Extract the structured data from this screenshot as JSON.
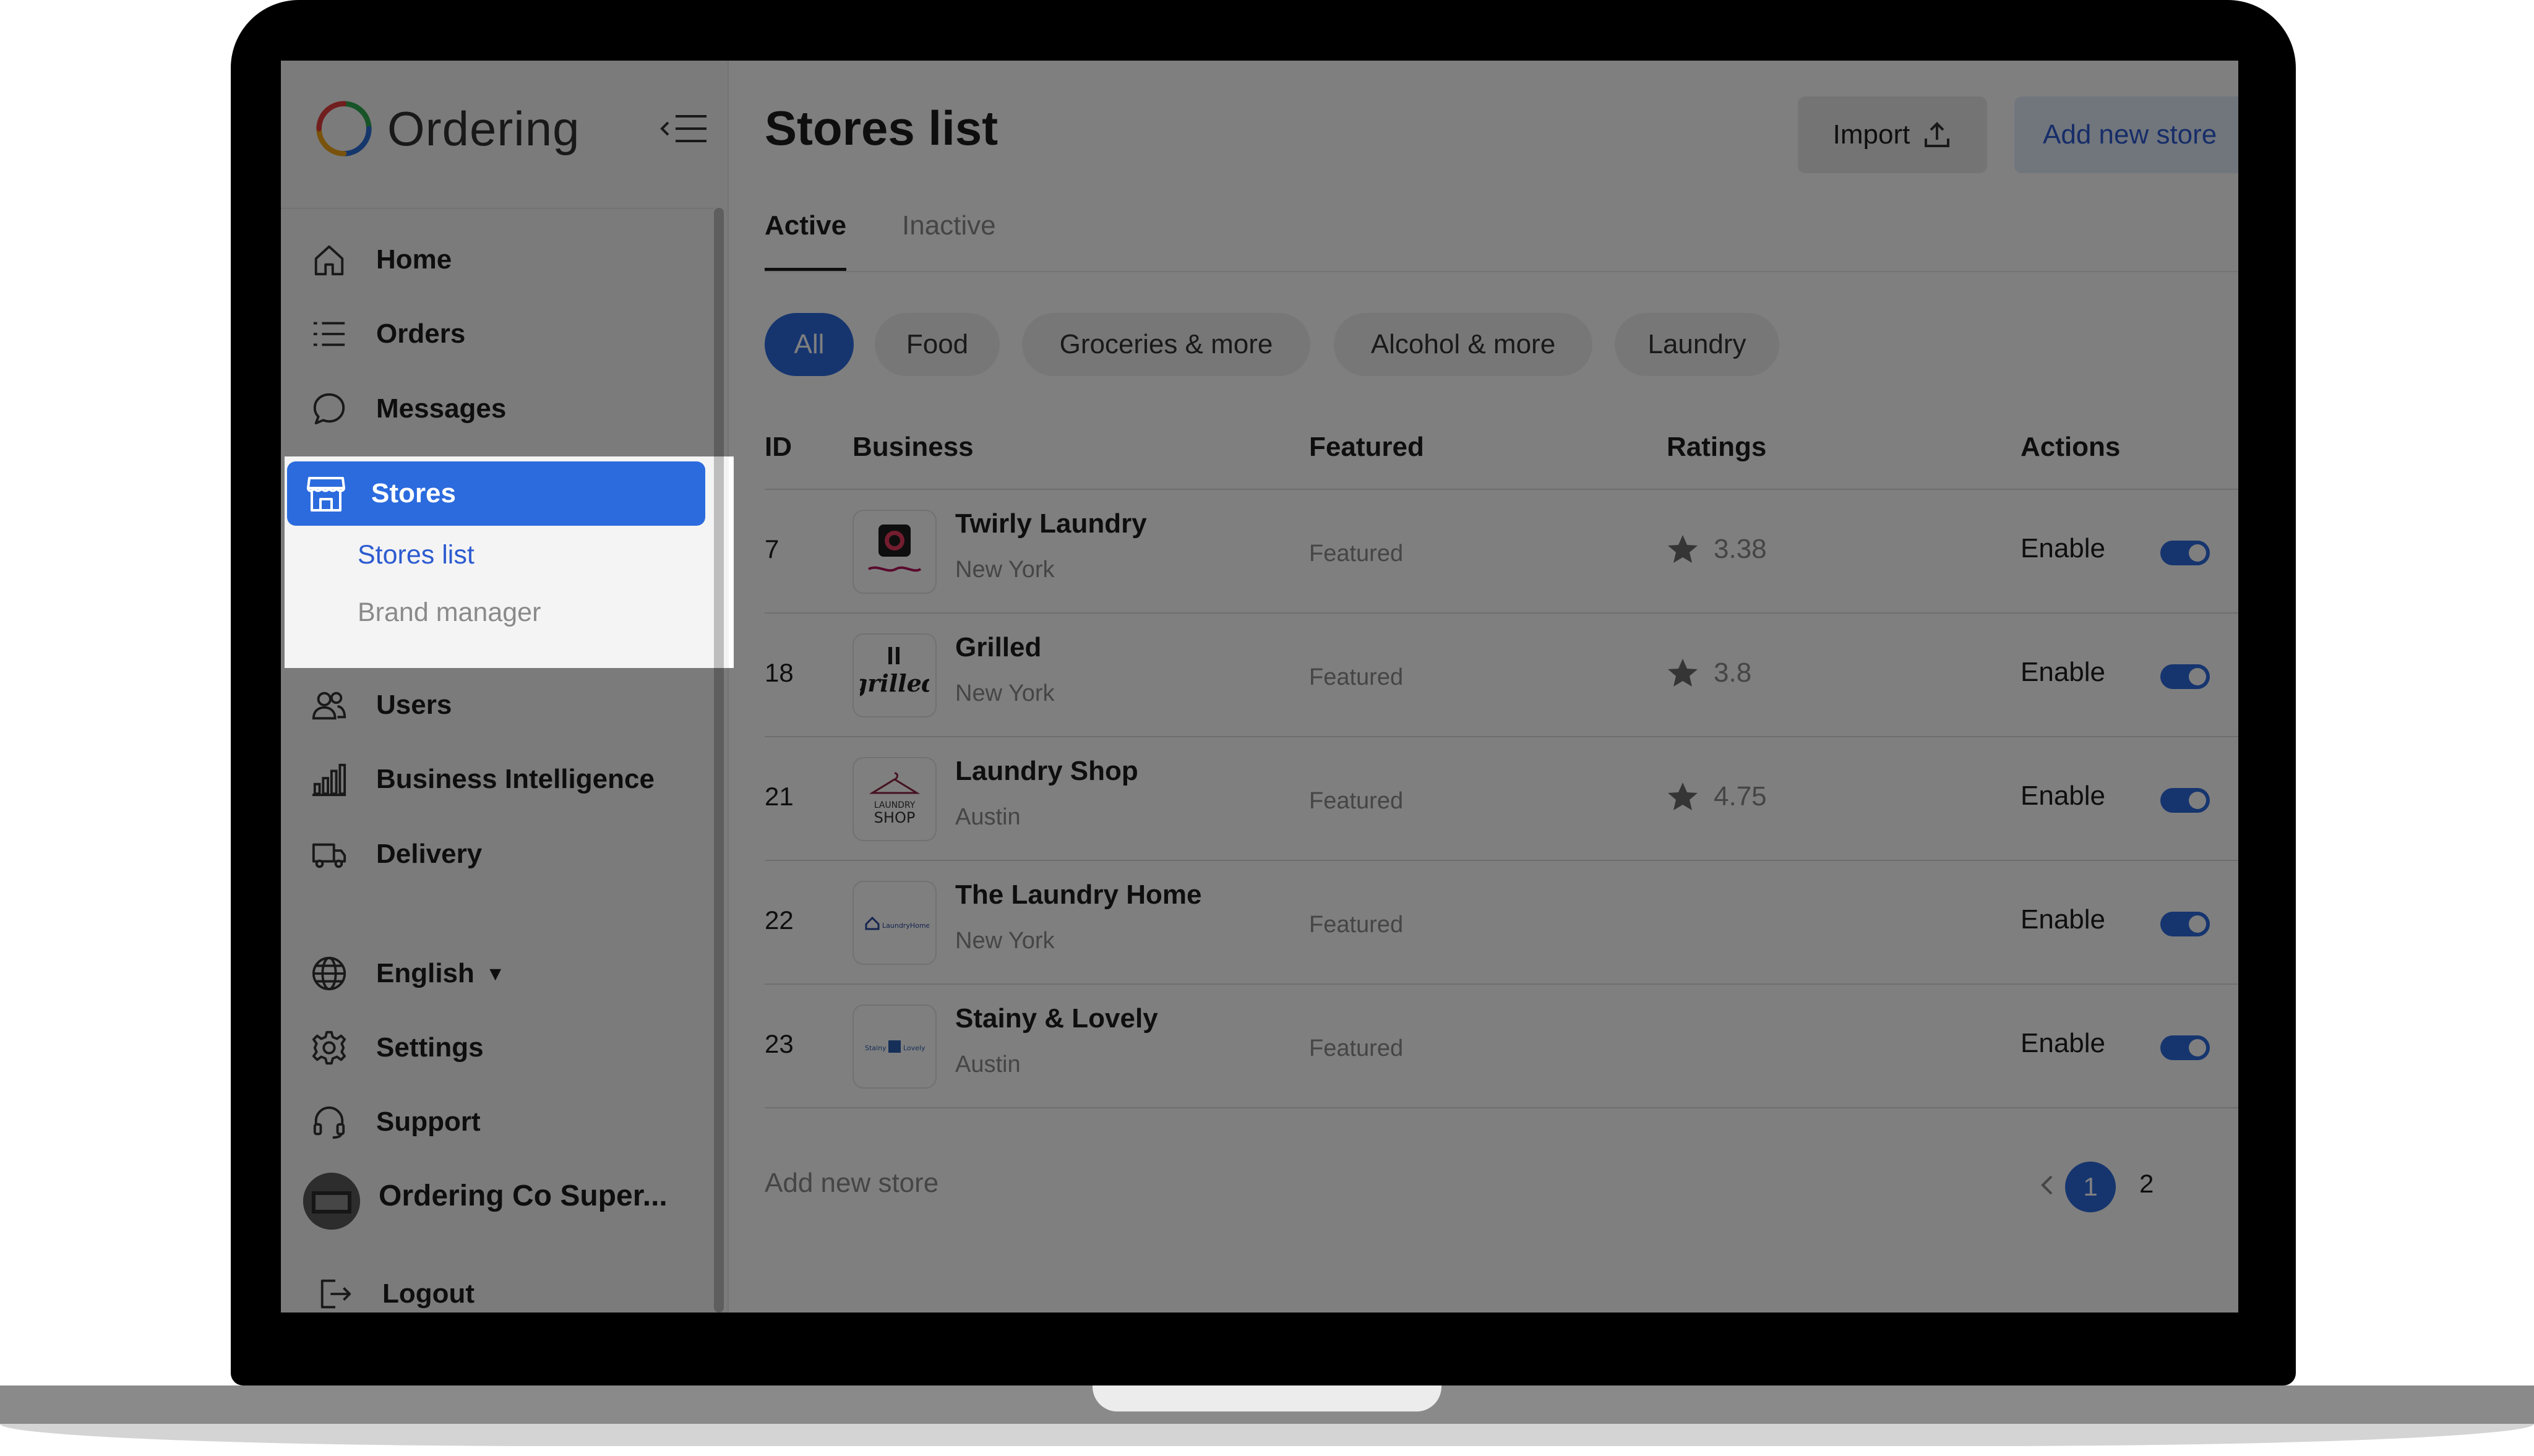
{
  "app": {
    "logo_text": "Ordering"
  },
  "colors": {
    "accent": "#2c6bde",
    "link": "#2c5bd0",
    "overlay": "rgba(0,0,0,0.5)"
  },
  "sidebar": {
    "items": [
      {
        "label": "Home",
        "icon": "home-icon"
      },
      {
        "label": "Orders",
        "icon": "list-icon"
      },
      {
        "label": "Messages",
        "icon": "chat-icon"
      },
      {
        "label": "Stores",
        "icon": "store-icon",
        "active": true
      },
      {
        "label": "Users",
        "icon": "users-icon"
      },
      {
        "label": "Business Intelligence",
        "icon": "bar-chart-icon"
      },
      {
        "label": "Delivery",
        "icon": "truck-icon"
      }
    ],
    "stores_submenu": [
      {
        "label": "Stores list",
        "active": true
      },
      {
        "label": "Brand manager"
      }
    ],
    "language": {
      "label": "English",
      "icon": "globe-icon"
    },
    "bottom_items": [
      {
        "label": "Settings",
        "icon": "gear-icon"
      },
      {
        "label": "Support",
        "icon": "headset-icon"
      }
    ],
    "profile_name": "Ordering Co Super...",
    "logout_label": "Logout"
  },
  "header": {
    "title": "Stores list",
    "import_label": "Import",
    "add_store_label": "Add new store"
  },
  "tabs": [
    {
      "label": "Active",
      "active": true
    },
    {
      "label": "Inactive"
    }
  ],
  "filters": [
    "All",
    "Food",
    "Groceries & more",
    "Alcohol & more",
    "Laundry"
  ],
  "table": {
    "columns": [
      "ID",
      "Business",
      "Featured",
      "Ratings",
      "Actions"
    ],
    "rows": [
      {
        "id": "7",
        "name": "Twirly Laundry",
        "city": "New York",
        "featured": "Featured",
        "rating": "3.38",
        "action": "Enable",
        "enabled": true
      },
      {
        "id": "18",
        "name": "Grilled",
        "city": "New York",
        "featured": "Featured",
        "rating": "3.8",
        "action": "Enable",
        "enabled": true
      },
      {
        "id": "21",
        "name": "Laundry Shop",
        "city": "Austin",
        "featured": "Featured",
        "rating": "4.75",
        "action": "Enable",
        "enabled": true
      },
      {
        "id": "22",
        "name": "The Laundry Home",
        "city": "New York",
        "featured": "Featured",
        "rating": "",
        "action": "Enable",
        "enabled": true
      },
      {
        "id": "23",
        "name": "Stainy & Lovely",
        "city": "Austin",
        "featured": "Featured",
        "rating": "",
        "action": "Enable",
        "enabled": true
      }
    ],
    "thumbs": {
      "grilled": "grilled",
      "laundry_shop_top": "LAUNDRY",
      "laundry_shop_bottom": "SHOP",
      "laundry_home": "LaundryHome",
      "stainy": "Stainy",
      "lovely": "Lovely"
    }
  },
  "footer": {
    "add_store_label": "Add new store",
    "pagination": {
      "current": "1",
      "next": "2"
    }
  }
}
